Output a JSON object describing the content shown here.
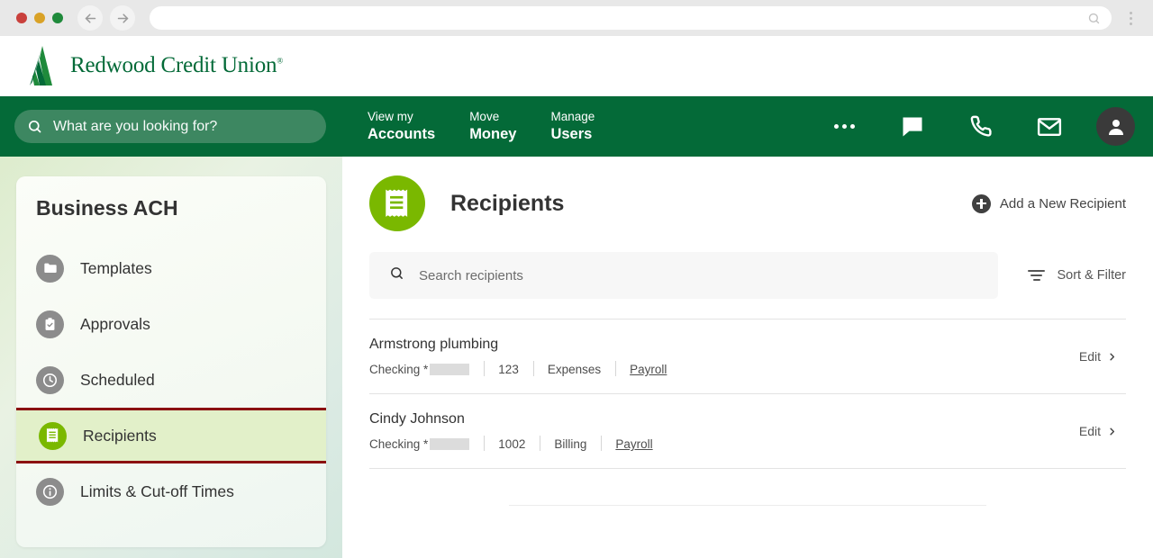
{
  "browser": {
    "back_icon": "back-arrow-icon",
    "forward_icon": "forward-arrow-icon",
    "address_value": "",
    "address_placeholder": "",
    "search_icon": "search-icon",
    "menu_icon": "kebab-menu-icon"
  },
  "brand": {
    "name": "Redwood Credit Union",
    "trademark": "®",
    "logo_icon": "redwood-tree-logo",
    "color": "#046a38"
  },
  "nav": {
    "search_placeholder": "What are you looking for?",
    "search_icon": "search-icon",
    "links": [
      {
        "top": "View my",
        "bottom": "Accounts"
      },
      {
        "top": "Move",
        "bottom": "Money"
      },
      {
        "top": "Manage",
        "bottom": "Users"
      }
    ],
    "icons": [
      {
        "name": "more-options-icon",
        "label": "More"
      },
      {
        "name": "chat-icon",
        "label": "Chat"
      },
      {
        "name": "phone-icon",
        "label": "Call"
      },
      {
        "name": "mail-icon",
        "label": "Messages"
      }
    ],
    "avatar_icon": "user-avatar-icon",
    "background_color": "#046a38",
    "search_background": "#3d8761"
  },
  "sidebar": {
    "title": "Business ACH",
    "items": [
      {
        "label": "Templates",
        "icon": "folder-icon",
        "active": false
      },
      {
        "label": "Approvals",
        "icon": "clipboard-check-icon",
        "active": false
      },
      {
        "label": "Scheduled",
        "icon": "clock-icon",
        "active": false
      },
      {
        "label": "Recipients",
        "icon": "receipt-icon",
        "active": true
      },
      {
        "label": "Limits & Cut-off Times",
        "icon": "info-icon",
        "active": false
      }
    ],
    "highlight_border_color": "#8b1111",
    "active_background": "#e2f0c9",
    "active_icon_color": "#7ab800"
  },
  "main": {
    "title": "Recipients",
    "title_icon": "receipt-icon",
    "title_icon_color": "#7ab800",
    "add_button": {
      "label": "Add a New Recipient",
      "icon": "plus-circle-icon"
    },
    "search": {
      "placeholder": "Search recipients",
      "value": "",
      "icon": "search-icon"
    },
    "sort_filter": {
      "label": "Sort & Filter",
      "icon": "filter-icon"
    },
    "edit_label": "Edit",
    "edit_chevron_icon": "chevron-right-icon",
    "recipients": [
      {
        "name": "Armstrong plumbing",
        "account_type": "Checking *",
        "account_redacted": true,
        "number": "123",
        "category": "Expenses",
        "tag": "Payroll"
      },
      {
        "name": "Cindy Johnson",
        "account_type": "Checking *",
        "account_redacted": true,
        "number": "1002",
        "category": "Billing",
        "tag": "Payroll"
      }
    ]
  }
}
